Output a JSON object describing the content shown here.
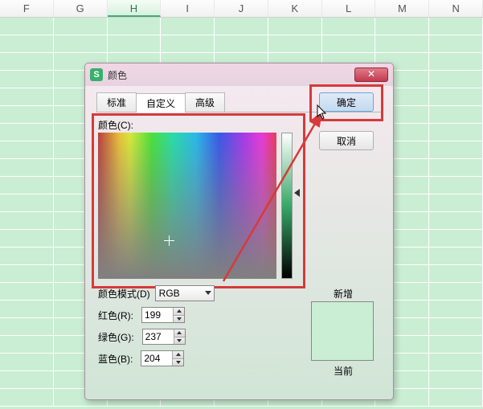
{
  "columns": [
    "F",
    "G",
    "H",
    "I",
    "J",
    "K",
    "L",
    "M",
    "N"
  ],
  "selected_column": "H",
  "dialog": {
    "title": "颜色",
    "tabs": {
      "standard": "标准",
      "custom": "自定义",
      "advanced": "高级"
    },
    "ok": "确定",
    "cancel": "取消",
    "color_label": "颜色(C):",
    "mode_label": "颜色模式(D)",
    "mode_value": "RGB",
    "red_label": "红色(R):",
    "green_label": "绿色(G):",
    "blue_label": "蓝色(B):",
    "red_value": "199",
    "green_value": "237",
    "blue_value": "204",
    "new_label": "新增",
    "current_label": "当前",
    "preview_color": "#c7edcc"
  }
}
